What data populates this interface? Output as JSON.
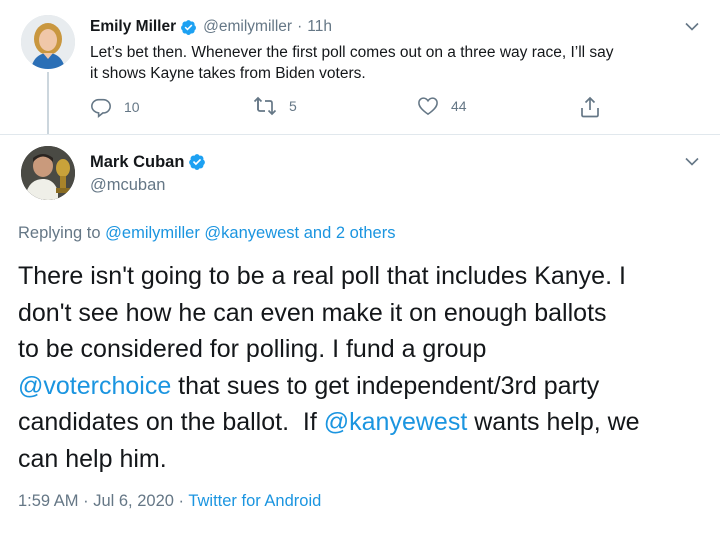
{
  "reply_tweet": {
    "display_name": "Emily Miller",
    "handle": "@emilymiller",
    "separator": "·",
    "time": "11h",
    "text_lines": [
      "Let’s bet then. Whenever the first poll comes out on a three way race, I’ll say",
      "it shows Kayne takes from Biden voters."
    ],
    "actions": {
      "reply_count": "10",
      "retweet_count": "5",
      "like_count": "44"
    },
    "avatar_icon": "woman-portrait-avatar"
  },
  "main_tweet": {
    "display_name": "Mark Cuban",
    "handle": "@mcuban",
    "avatar_icon": "man-portrait-avatar",
    "replying": {
      "prefix": "Replying to",
      "mention_1": "@emilymiller",
      "mention_2": "@kanyewest",
      "and_others": "and 2 others"
    },
    "body": {
      "line_1": "There isn't going to be a real poll that includes Kanye. I",
      "line_2": "don't see how he can even make it on enough ballots",
      "line_3": "to be considered for polling. I fund a group",
      "line_4_mention": "@voterchoice",
      "line_4_rest": " that sues to get independent/3rd party",
      "line_5_pre": "candidates on the ballot.  If ",
      "line_5_mention": "@kanyewest",
      "line_5_post": " wants help, we",
      "line_6": "can help him."
    },
    "meta": {
      "timestamp": "1:59 AM · Jul 6, 2020",
      "separator": " · ",
      "source": "Twitter for Android"
    }
  },
  "colors": {
    "text": "#14171a",
    "muted": "#657786",
    "link": "#1b95e0",
    "verified": "#1da1f2",
    "divider": "#e1e8ed"
  }
}
